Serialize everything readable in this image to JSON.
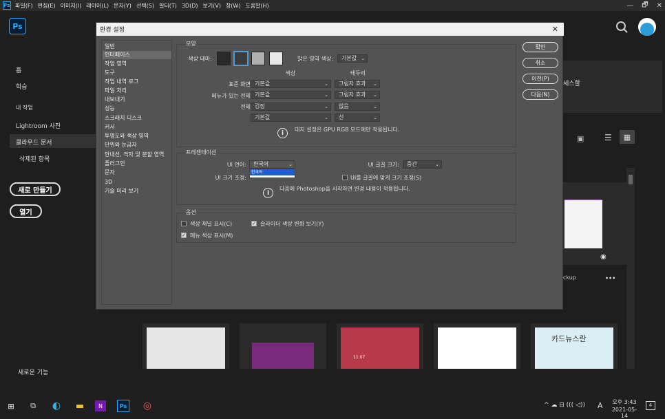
{
  "menubar": {
    "items": [
      "파일(F)",
      "편집(E)",
      "이미지(I)",
      "레이어(L)",
      "문자(Y)",
      "선택(S)",
      "필터(T)",
      "3D(D)",
      "보기(V)",
      "창(W)",
      "도움말(H)"
    ],
    "app_icon": "Ps",
    "window_controls": [
      "—",
      "🗗",
      "✕"
    ]
  },
  "home": {
    "logo": "Ps",
    "nav": [
      "홈",
      "학습",
      "내 작업",
      "Lightroom 사진",
      "클라우드 문서",
      "삭제된 항목"
    ],
    "create_new_label": "새로 만들기",
    "open_label": "열기",
    "whats_new_label": "새로운 기능",
    "peek_text_1": "세스할",
    "peek_text_2": "ckup",
    "thumb_card_text": "카드뉴스란",
    "thumb_time": "11:07",
    "more_dots": "•••"
  },
  "dialog": {
    "title": "환경 설정",
    "close": "✕",
    "categories": [
      "일반",
      "인터페이스",
      "작업 영역",
      "도구",
      "작업 내역 로그",
      "파일 처리",
      "내보내기",
      "성능",
      "스크래치 디스크",
      "커서",
      "투명도와 색상 영역",
      "단위와 눈금자",
      "안내선, 격자 및 분할 영역",
      "플러그인",
      "문자",
      "3D",
      "기술 미리 보기"
    ],
    "selected_category": "인터페이스",
    "appearance": {
      "group_label": "모양",
      "color_theme_label": "색상 테마:",
      "highlight_label": "밝은 영역 색상:",
      "highlight_value": "기본값",
      "col_color": "색상",
      "col_border": "테두리",
      "rows": [
        {
          "label": "표준 화면 모드:",
          "color": "기본값",
          "border": "그림자 효과"
        },
        {
          "label": "메뉴가 있는 전체 화면:",
          "color": "기본값",
          "border": "그림자 효과"
        },
        {
          "label": "전체 화면:",
          "color": "검정",
          "border": "없음"
        },
        {
          "label": "대지:",
          "color": "기본값",
          "border": "선"
        }
      ],
      "note": "대지 설정은 GPU RGB 모드에만 적용됩니다.",
      "swatches": [
        "#2a2a2a",
        "#3c3c3c",
        "#b0b0b0",
        "#e8e8e8"
      ]
    },
    "presentation": {
      "group_label": "프레젠테이션",
      "ui_language_label": "UI 언어:",
      "ui_language_value": "한국어",
      "ui_language_dropdown_options": [
        "한국어",
        ""
      ],
      "ui_font_size_label": "UI 글꼴 크기:",
      "ui_font_size_value": "중간",
      "ui_scale_label": "UI 크기 조정:",
      "scale_to_font_label": "UI를 글꼴에 맞게 크기 조정(S)",
      "note": "다음에 Photoshop을 시작하면 변경 내용이 적용됩니다."
    },
    "options": {
      "group_label": "옵션",
      "show_channels_color": "색상 채널 표시(C)",
      "dynamic_color_sliders": "슬라이더 색상 변화 보기(Y)",
      "show_menu_colors": "메뉴 색상 표시(M)"
    },
    "buttons": {
      "ok": "확인",
      "cancel": "취소",
      "prev": "이전(P)",
      "next": "다음(N)"
    }
  },
  "taskbar": {
    "time": "오후 3:43",
    "date": "2021-05-14",
    "ime": "A",
    "notif": "4"
  }
}
